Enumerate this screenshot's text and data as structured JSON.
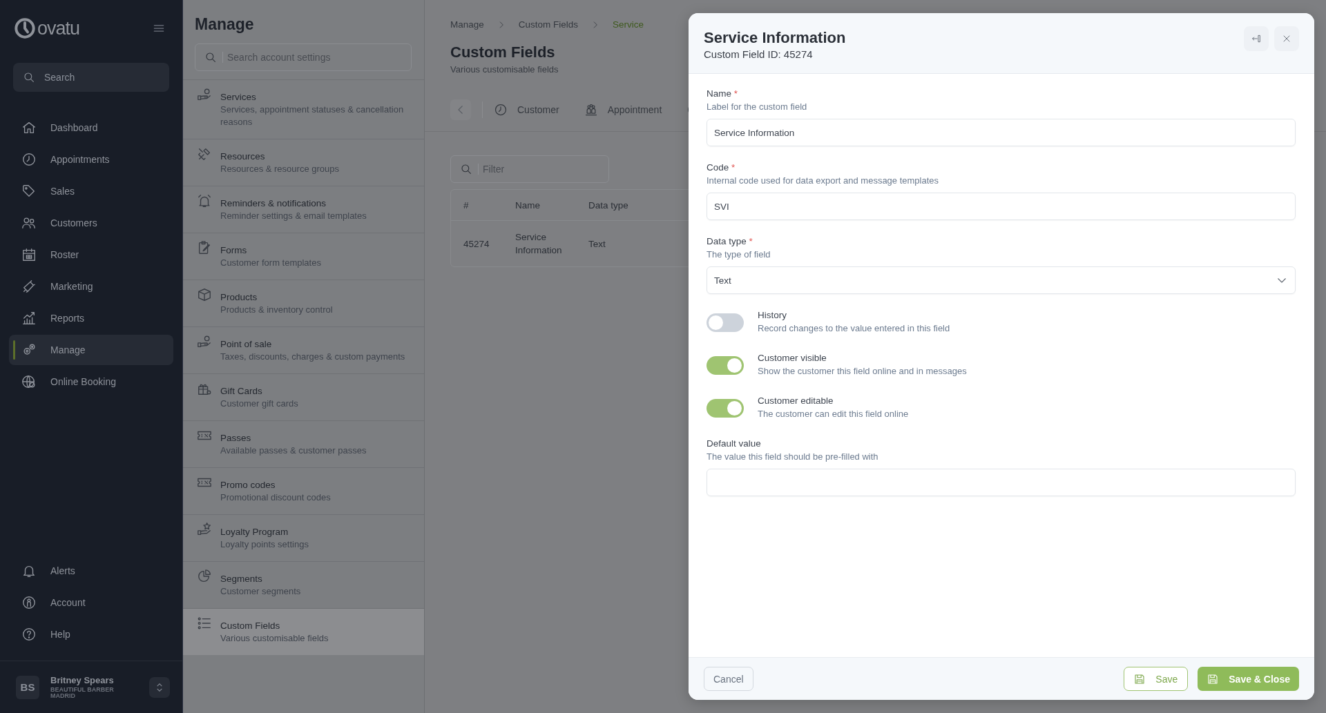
{
  "brand": {
    "name": "ovatu"
  },
  "sidebar": {
    "search": {
      "placeholder": "Search"
    },
    "items": [
      {
        "label": "Dashboard",
        "selected": false
      },
      {
        "label": "Appointments",
        "selected": false
      },
      {
        "label": "Sales",
        "selected": false
      },
      {
        "label": "Customers",
        "selected": false
      },
      {
        "label": "Roster",
        "selected": false
      },
      {
        "label": "Marketing",
        "selected": false
      },
      {
        "label": "Reports",
        "selected": false
      },
      {
        "label": "Manage",
        "selected": true
      },
      {
        "label": "Online Booking",
        "selected": false
      }
    ],
    "bottom_items": [
      {
        "label": "Alerts"
      },
      {
        "label": "Account"
      },
      {
        "label": "Help"
      }
    ],
    "user": {
      "initials": "BS",
      "name": "Britney Spears",
      "business": "BEAUTIFUL BARBER MADRID"
    }
  },
  "manage": {
    "title": "Manage",
    "search": {
      "placeholder": "Search account settings"
    },
    "items": [
      {
        "title": "Services",
        "subtitle": "Services, appointment statuses & cancellation reasons",
        "selected": false
      },
      {
        "title": "Resources",
        "subtitle": "Resources & resource groups",
        "selected": false
      },
      {
        "title": "Reminders & notifications",
        "subtitle": "Reminder settings & email templates",
        "selected": false
      },
      {
        "title": "Forms",
        "subtitle": "Customer form templates",
        "selected": false
      },
      {
        "title": "Products",
        "subtitle": "Products & inventory control",
        "selected": false
      },
      {
        "title": "Point of sale",
        "subtitle": "Taxes, discounts, charges & custom payments",
        "selected": false
      },
      {
        "title": "Gift Cards",
        "subtitle": "Customer gift cards",
        "selected": false
      },
      {
        "title": "Passes",
        "subtitle": "Available passes & customer passes",
        "selected": false
      },
      {
        "title": "Promo codes",
        "subtitle": "Promotional discount codes",
        "selected": false
      },
      {
        "title": "Loyalty Program",
        "subtitle": "Loyalty points settings",
        "selected": false
      },
      {
        "title": "Segments",
        "subtitle": "Customer segments",
        "selected": false
      },
      {
        "title": "Custom Fields",
        "subtitle": "Various customisable fields",
        "selected": true
      }
    ]
  },
  "breadcrumb": [
    {
      "label": "Manage",
      "current": false
    },
    {
      "label": "Custom Fields",
      "current": false
    },
    {
      "label": "Service",
      "current": true
    }
  ],
  "page": {
    "title": "Custom Fields",
    "subtitle": "Various customisable fields"
  },
  "tabs": [
    {
      "label": "Customer",
      "selected": false
    },
    {
      "label": "Appointment",
      "selected": false
    }
  ],
  "filter": {
    "placeholder": "Filter"
  },
  "table": {
    "columns": [
      "#",
      "Name",
      "Data type"
    ],
    "rows": [
      [
        "45274",
        "Service Information",
        "Text"
      ]
    ]
  },
  "dialog": {
    "title": "Service Information",
    "subtitle": "Custom Field ID: 45274",
    "fields": [
      {
        "kind": "input",
        "label": "Name",
        "required_mark": "*",
        "hint": "Label for the custom field",
        "value": "Service Information"
      },
      {
        "kind": "input",
        "label": "Code",
        "required_mark": "*",
        "hint": "Internal code used for data export and message templates",
        "value": "SVI"
      },
      {
        "kind": "select",
        "label": "Data type",
        "required_mark": "*",
        "hint": "The type of field",
        "value": "Text"
      },
      {
        "kind": "toggle",
        "label": "History",
        "hint": "Record changes to the value entered in this field",
        "on": false
      },
      {
        "kind": "toggle",
        "label": "Customer visible",
        "hint": "Show the customer this field online and in messages",
        "on": true
      },
      {
        "kind": "toggle",
        "label": "Customer editable",
        "hint": "The customer can edit this field online",
        "on": true
      },
      {
        "kind": "input",
        "label": "Default value",
        "hint": "The value this field should be pre-filled with"
      }
    ],
    "buttons": [
      {
        "label": "Cancel",
        "kind": "cancel"
      },
      {
        "label": "Save",
        "kind": "secondary"
      },
      {
        "label": "Save & Close",
        "kind": "primary"
      }
    ]
  }
}
